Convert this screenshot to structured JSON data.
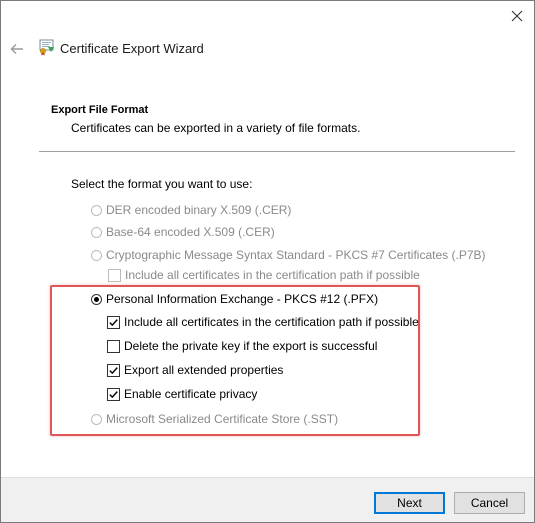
{
  "window": {
    "title": "Certificate Export Wizard"
  },
  "page": {
    "heading": "Export File Format",
    "description": "Certificates can be exported in a variety of file formats.",
    "prompt": "Select the format you want to use:"
  },
  "formats": [
    {
      "label": "DER encoded binary X.509 (.CER)",
      "selected": false,
      "enabled": false
    },
    {
      "label": "Base-64 encoded X.509 (.CER)",
      "selected": false,
      "enabled": false
    },
    {
      "label": "Cryptographic Message Syntax Standard - PKCS #7 Certificates (.P7B)",
      "selected": false,
      "enabled": false
    },
    {
      "label": "Personal Information Exchange - PKCS #12 (.PFX)",
      "selected": true,
      "enabled": true
    },
    {
      "label": "Microsoft Serialized Certificate Store (.SST)",
      "selected": false,
      "enabled": false
    }
  ],
  "p7b_options": [
    {
      "label": "Include all certificates in the certification path if possible",
      "checked": false,
      "enabled": false
    }
  ],
  "pfx_options": [
    {
      "label": "Include all certificates in the certification path if possible",
      "checked": true,
      "enabled": true
    },
    {
      "label": "Delete the private key if the export is successful",
      "checked": false,
      "enabled": true
    },
    {
      "label": "Export all extended properties",
      "checked": true,
      "enabled": true
    },
    {
      "label": "Enable certificate privacy",
      "checked": true,
      "enabled": true
    }
  ],
  "buttons": {
    "next": "Next",
    "cancel": "Cancel"
  },
  "colors": {
    "highlight": "#e05555",
    "accent": "#0078d7",
    "disabled_text": "#8a8a8a"
  },
  "icons": {
    "close": "close-icon",
    "back": "back-arrow-icon",
    "wizard": "certificate-icon"
  }
}
